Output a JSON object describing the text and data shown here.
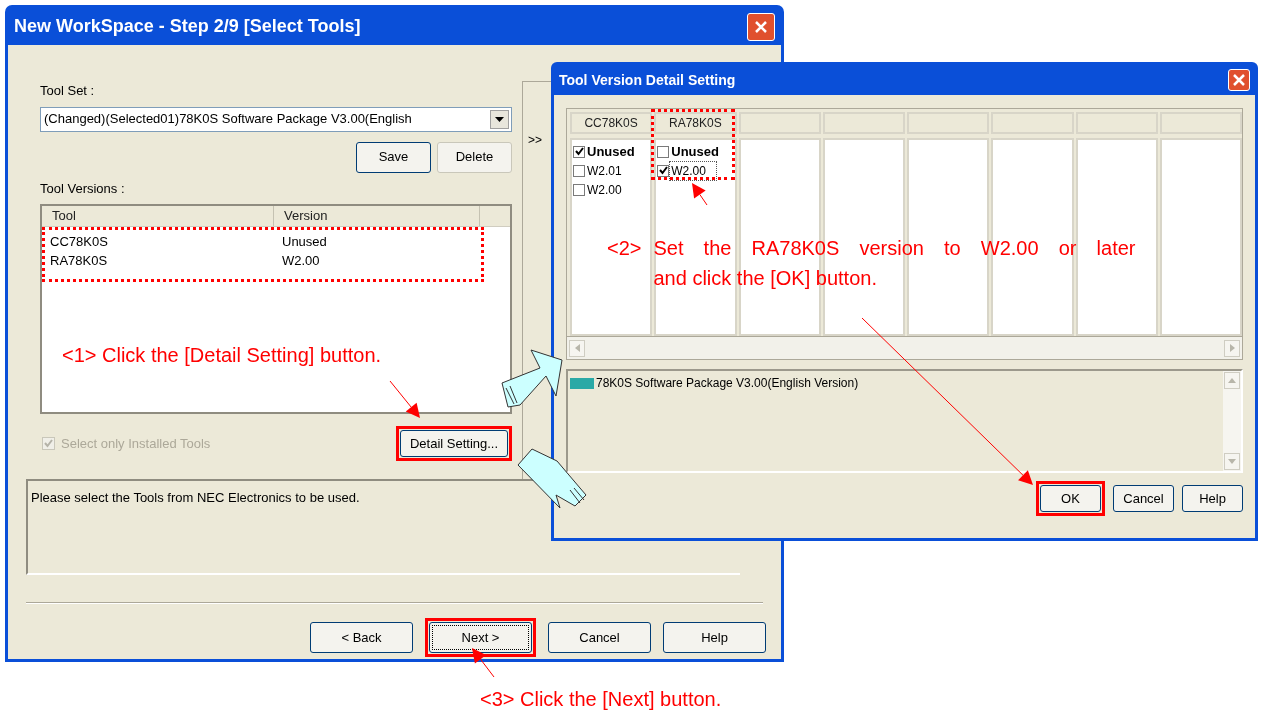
{
  "main_window": {
    "title": "New WorkSpace - Step 2/9 [Select Tools]",
    "tool_set_label": "Tool Set :",
    "tool_set_value": "(Changed)(Selected01)78K0S Software Package V3.00(English",
    "tool_set_buttons": [
      {
        "label": "Save",
        "disabled": false
      },
      {
        "label": "Delete",
        "disabled": true
      }
    ],
    "side_panel_text": ">>",
    "tool_versions_label": "Tool Versions :",
    "table": {
      "columns": [
        "Tool",
        "Version"
      ],
      "highlighted": true,
      "rows": [
        [
          "CC78K0S",
          "Unused"
        ],
        [
          "RA78K0S",
          "W2.00"
        ]
      ]
    },
    "installed_only": {
      "label": "Select only Installed Tools",
      "checked": true,
      "disabled": true
    },
    "detail_button": {
      "label": "Detail Setting...",
      "highlighted": true
    },
    "description": "Please select the Tools from NEC Electronics to be used.",
    "nav_buttons": [
      {
        "label": "< Back",
        "focused": false,
        "highlighted": false
      },
      {
        "label": "Next >",
        "focused": true,
        "highlighted": true
      },
      {
        "label": "Cancel",
        "focused": false,
        "highlighted": false
      },
      {
        "label": "Help",
        "focused": false,
        "highlighted": false
      }
    ]
  },
  "detail_window": {
    "title": "Tool Version Detail Setting",
    "columns": [
      {
        "header": "CC78K0S",
        "highlighted": false,
        "options": [
          {
            "kind": "unused",
            "label": "Unused",
            "checked": true,
            "focused": false
          },
          {
            "kind": "version",
            "label": "W2.01",
            "checked": false,
            "focused": false
          },
          {
            "kind": "version",
            "label": "W2.00",
            "checked": false,
            "focused": false
          }
        ]
      },
      {
        "header": "RA78K0S",
        "highlighted": true,
        "options": [
          {
            "kind": "unused",
            "label": "Unused",
            "checked": false,
            "focused": false
          },
          {
            "kind": "version",
            "label": "W2.00",
            "checked": true,
            "focused": true
          }
        ]
      }
    ],
    "packages": [
      {
        "label": "78K0S Software Package V3.00(English Version)",
        "color": "#2aa9a6"
      }
    ],
    "buttons": [
      {
        "label": "OK",
        "highlighted": true
      },
      {
        "label": "Cancel",
        "highlighted": false
      },
      {
        "label": "Help",
        "highlighted": false
      }
    ]
  },
  "annotations": {
    "step_1": "<1> Click the [Detail Setting] button.",
    "step_2": {
      "number": "<2>",
      "lines": [
        "Set the RA78K0S version to W2.00 or later",
        "and click the [OK] button."
      ]
    },
    "step_3": "<3> Click the [Next] button."
  }
}
